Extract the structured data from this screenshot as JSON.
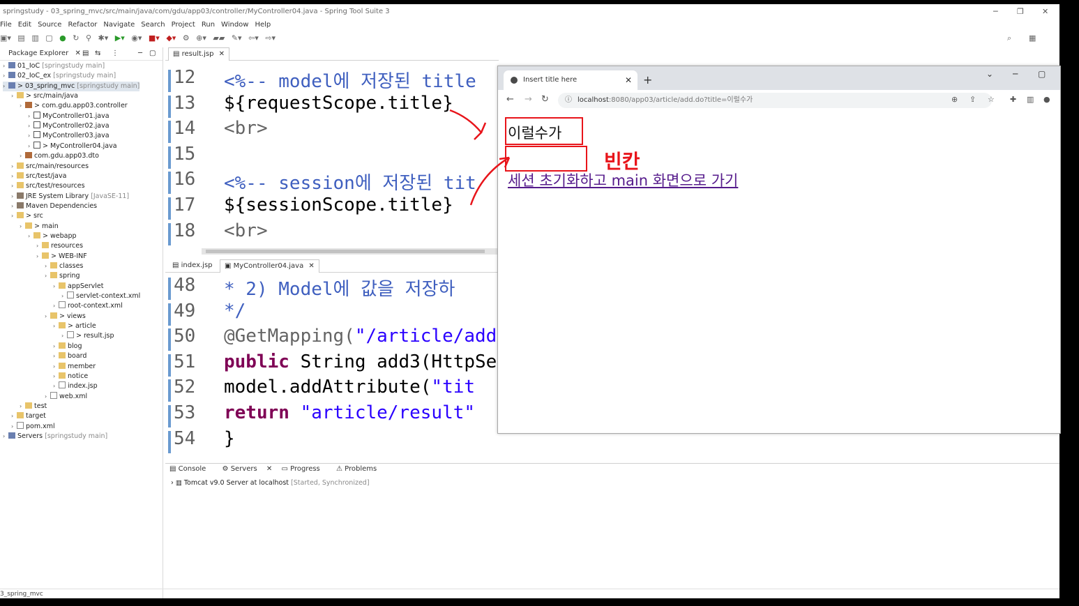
{
  "window": {
    "title": "springstudy - 03_spring_mvc/src/main/java/com/gdu/app03/controller/MyController04.java - Spring Tool Suite 3"
  },
  "menu": [
    "File",
    "Edit",
    "Source",
    "Refactor",
    "Navigate",
    "Search",
    "Project",
    "Run",
    "Window",
    "Help"
  ],
  "package_explorer": {
    "title": "Package Explorer",
    "items": [
      {
        "label": "01_IoC",
        "dec": "[springstudy main]"
      },
      {
        "label": "02_IoC_ex",
        "dec": "[springstudy main]"
      },
      {
        "label": "> 03_spring_mvc",
        "dec": "[springstudy main]"
      },
      {
        "label": "> src/main/java",
        "dec": ""
      },
      {
        "label": "> com.gdu.app03.controller",
        "dec": ""
      },
      {
        "label": "MyController01.java",
        "dec": ""
      },
      {
        "label": "MyController02.java",
        "dec": ""
      },
      {
        "label": "MyController03.java",
        "dec": ""
      },
      {
        "label": "> MyController04.java",
        "dec": ""
      },
      {
        "label": "com.gdu.app03.dto",
        "dec": ""
      },
      {
        "label": "src/main/resources",
        "dec": ""
      },
      {
        "label": "src/test/java",
        "dec": ""
      },
      {
        "label": "src/test/resources",
        "dec": ""
      },
      {
        "label": "JRE System Library",
        "dec": "[JavaSE-11]"
      },
      {
        "label": "Maven Dependencies",
        "dec": ""
      },
      {
        "label": "> src",
        "dec": ""
      },
      {
        "label": "> main",
        "dec": ""
      },
      {
        "label": "> webapp",
        "dec": ""
      },
      {
        "label": "resources",
        "dec": ""
      },
      {
        "label": "> WEB-INF",
        "dec": ""
      },
      {
        "label": "classes",
        "dec": ""
      },
      {
        "label": "spring",
        "dec": ""
      },
      {
        "label": "appServlet",
        "dec": ""
      },
      {
        "label": "servlet-context.xml",
        "dec": ""
      },
      {
        "label": "root-context.xml",
        "dec": ""
      },
      {
        "label": "> views",
        "dec": ""
      },
      {
        "label": "> article",
        "dec": ""
      },
      {
        "label": "> result.jsp",
        "dec": ""
      },
      {
        "label": "blog",
        "dec": ""
      },
      {
        "label": "board",
        "dec": ""
      },
      {
        "label": "member",
        "dec": ""
      },
      {
        "label": "notice",
        "dec": ""
      },
      {
        "label": "index.jsp",
        "dec": ""
      },
      {
        "label": "web.xml",
        "dec": ""
      },
      {
        "label": "test",
        "dec": ""
      },
      {
        "label": "target",
        "dec": ""
      },
      {
        "label": "pom.xml",
        "dec": ""
      },
      {
        "label": "Servers",
        "dec": "[springstudy main]"
      }
    ]
  },
  "editor1": {
    "tab": "result.jsp",
    "lines": [
      {
        "n": "12",
        "parts": [
          {
            "t": "<%-- model에 저장된 title",
            "c": "cm"
          }
        ]
      },
      {
        "n": "13",
        "parts": [
          {
            "t": "${requestScope.title}",
            "c": ""
          }
        ]
      },
      {
        "n": "14",
        "parts": [
          {
            "t": "<br>",
            "c": "ann"
          }
        ]
      },
      {
        "n": "15",
        "parts": [
          {
            "t": "",
            "c": ""
          }
        ]
      },
      {
        "n": "16",
        "parts": [
          {
            "t": "<%-- session에 저장된 tit",
            "c": "cm"
          }
        ]
      },
      {
        "n": "17",
        "parts": [
          {
            "t": "${sessionScope.title}",
            "c": ""
          }
        ]
      },
      {
        "n": "18",
        "parts": [
          {
            "t": "<br>",
            "c": "ann"
          }
        ]
      }
    ]
  },
  "editor2": {
    "tabs": [
      "index.jsp",
      "MyController04.java"
    ],
    "lines": [
      {
        "n": "48",
        "parts": [
          {
            "t": " *  2) Model에 값을 저장하",
            "c": "cm"
          }
        ]
      },
      {
        "n": "49",
        "parts": [
          {
            "t": " */",
            "c": "cm"
          }
        ]
      },
      {
        "n": "50",
        "parts": [
          {
            "t": "@GetMapping(",
            "c": "ann"
          },
          {
            "t": "\"/article/add",
            "c": "str"
          }
        ]
      },
      {
        "n": "51",
        "parts": [
          {
            "t": "public ",
            "c": "kw"
          },
          {
            "t": "String add3(HttpSe",
            "c": ""
          }
        ]
      },
      {
        "n": "52",
        "parts": [
          {
            "t": "  model.addAttribute(",
            "c": ""
          },
          {
            "t": "\"tit",
            "c": "str"
          }
        ]
      },
      {
        "n": "53",
        "parts": [
          {
            "t": "  return ",
            "c": "kw"
          },
          {
            "t": "\"article/result\"",
            "c": "str"
          }
        ]
      },
      {
        "n": "54",
        "parts": [
          {
            "t": "}",
            "c": ""
          }
        ]
      }
    ]
  },
  "console": {
    "tabs": [
      "Console",
      "Servers",
      "Progress",
      "Problems"
    ],
    "server": "Tomcat v9.0 Server at localhost",
    "server_state": "[Started, Synchronized]"
  },
  "status": "3_spring_mvc",
  "browser": {
    "tab_title": "Insert title here",
    "url_host": "localhost",
    "url_rest": ":8080/app03/article/add.do?title=이럴수가",
    "content_text": "이럴수가",
    "content_link": "세션 초기화하고 main 화면으로 가기"
  },
  "annotation": {
    "note": "빈칸",
    "color": "#e8141a"
  }
}
